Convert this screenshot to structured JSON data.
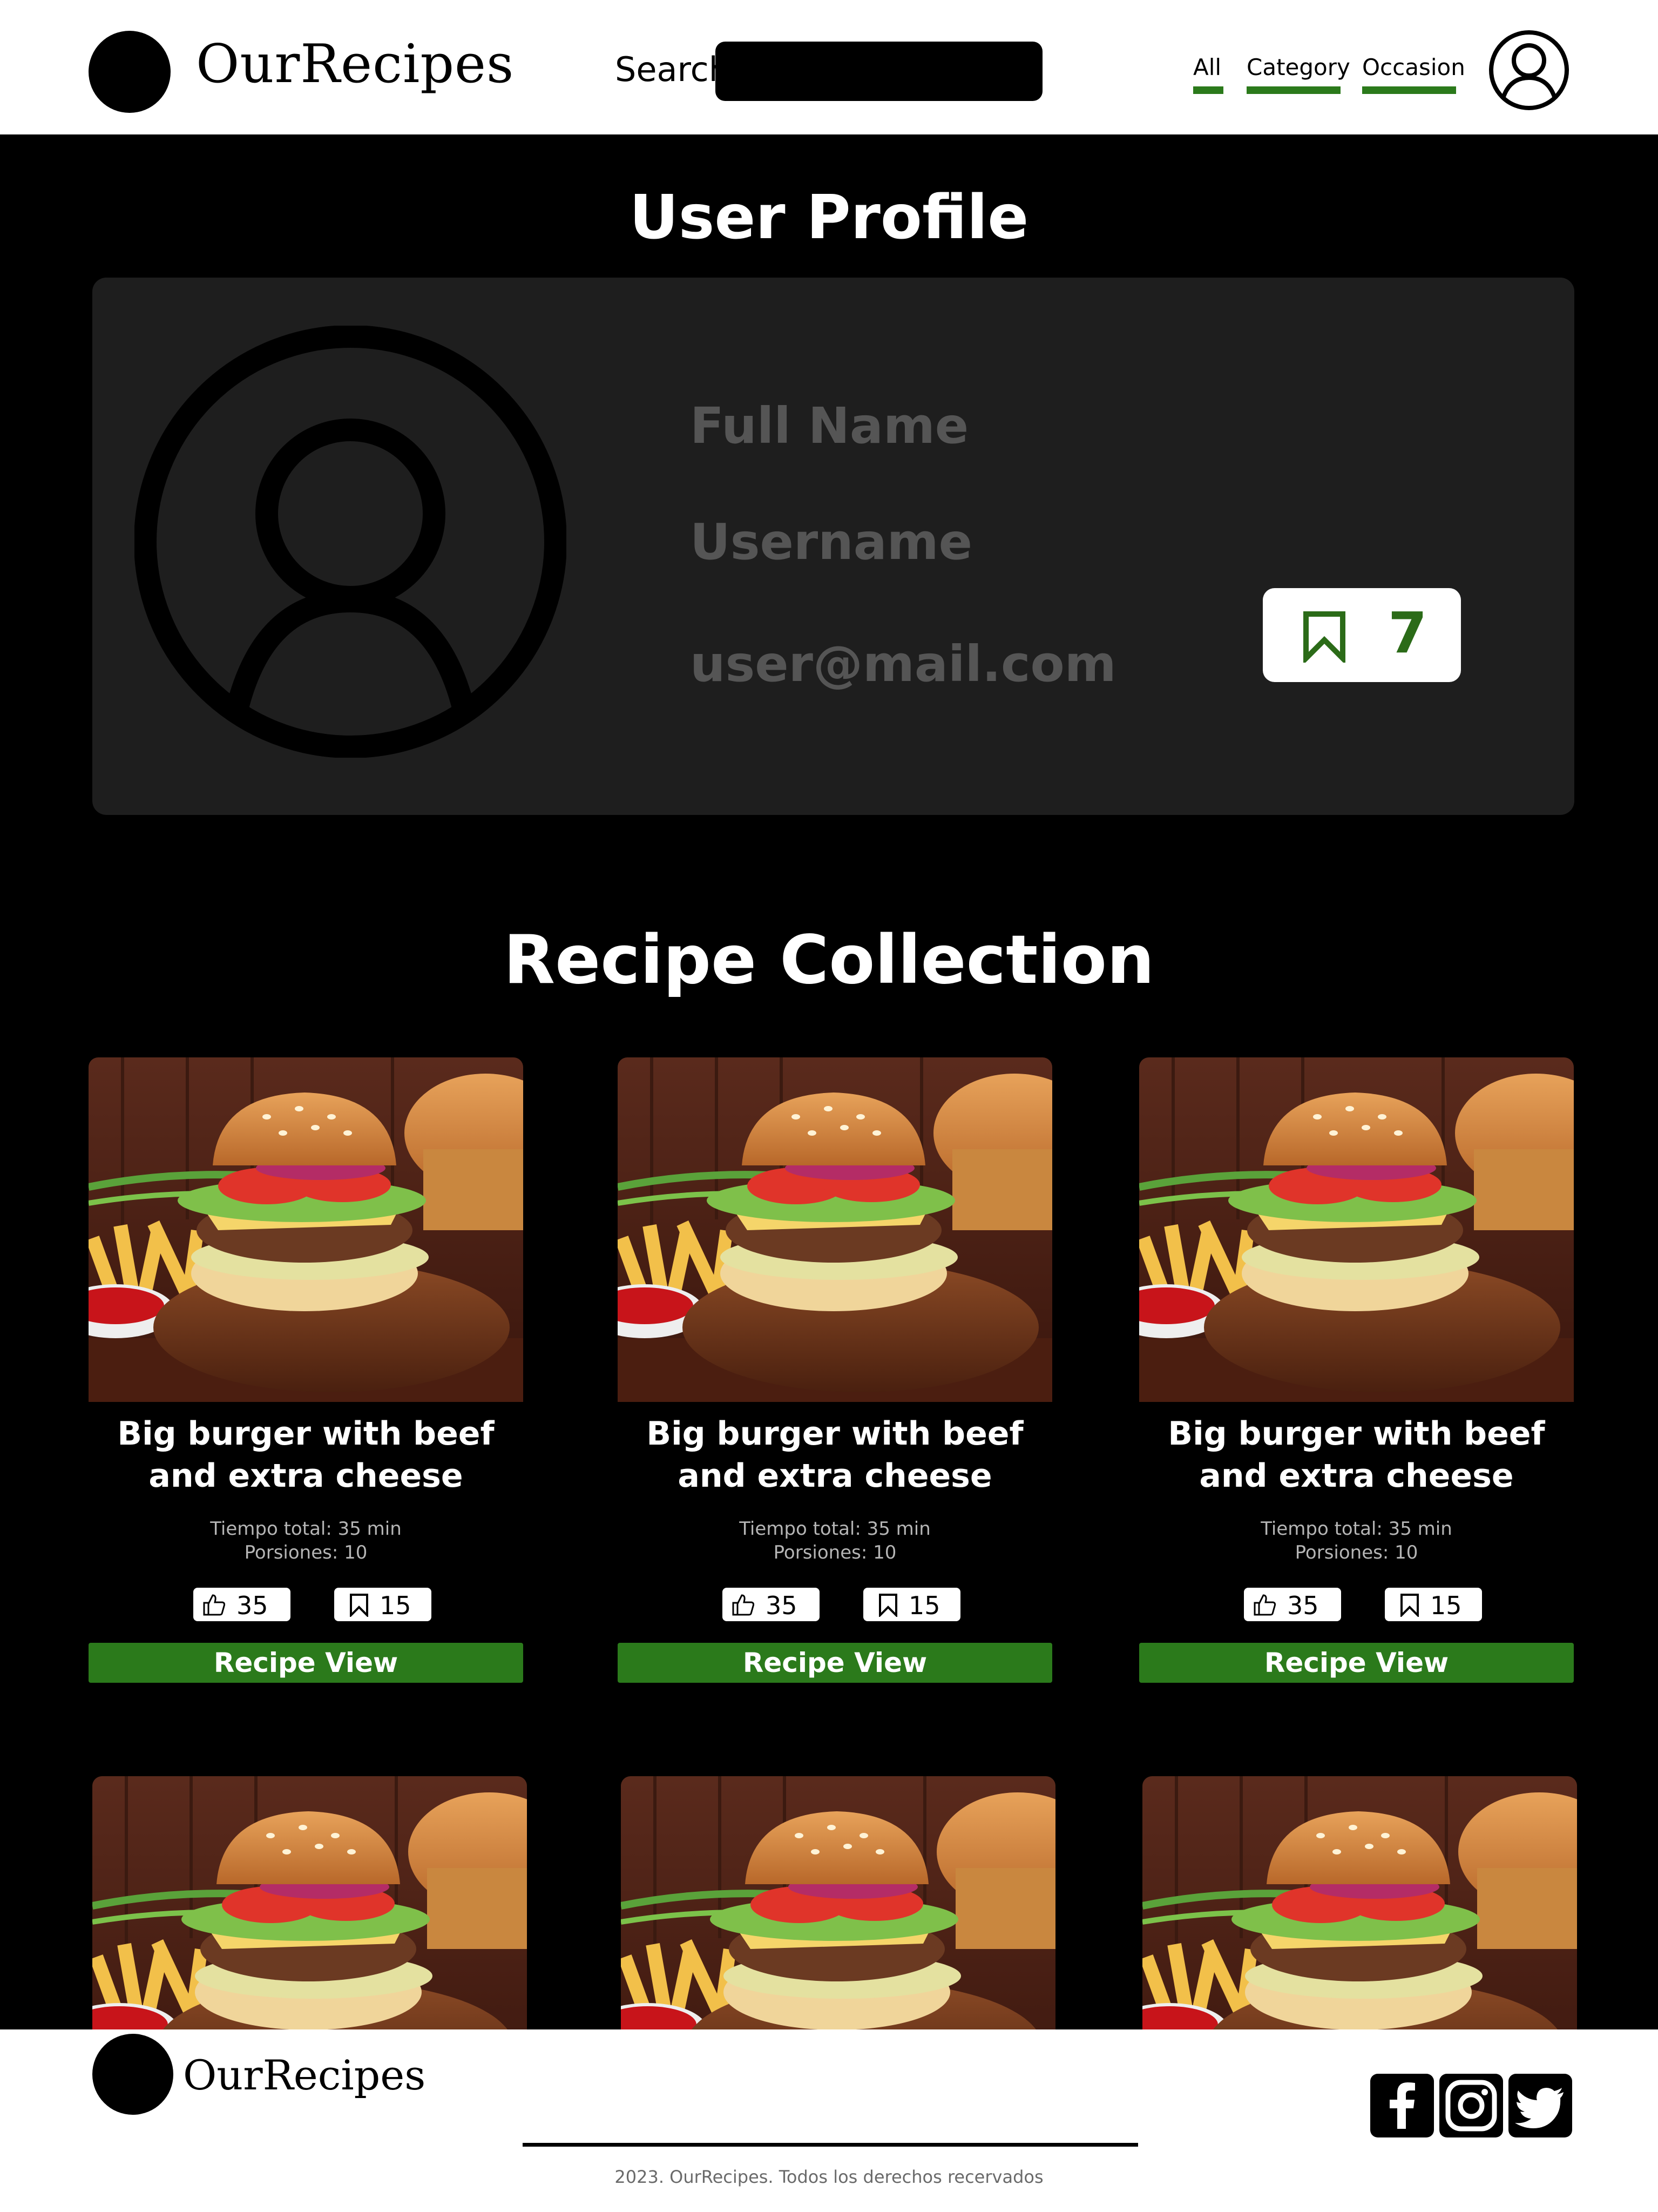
{
  "header": {
    "logo_text": "OurRecipes",
    "search_label": "Search",
    "search_value": "",
    "nav": [
      {
        "label": "All"
      },
      {
        "label": "Category"
      },
      {
        "label": "Occasion"
      }
    ],
    "accent_color": "#2b7a1b"
  },
  "profile": {
    "title": "User Profile",
    "full_name": "Full Name",
    "username": "Username",
    "email": "user@mail.com",
    "saved_count": "7"
  },
  "collection": {
    "title": "Recipe Collection",
    "cards": [
      {
        "title": "Big burger with beef and extra cheese",
        "time": "Tiempo total: 35 min",
        "servings": "Porsiones: 10",
        "likes": "35",
        "saves": "15",
        "button": "Recipe View"
      },
      {
        "title": "Big burger with beef and extra cheese",
        "time": "Tiempo total: 35 min",
        "servings": "Porsiones: 10",
        "likes": "35",
        "saves": "15",
        "button": "Recipe View"
      },
      {
        "title": "Big burger with beef and extra cheese",
        "time": "Tiempo total: 35 min",
        "servings": "Porsiones: 10",
        "likes": "35",
        "saves": "15",
        "button": "Recipe View"
      }
    ]
  },
  "footer": {
    "logo_text": "OurRecipes",
    "copyright": "2023. OurRecipes. Todos los derechos recervados",
    "social": [
      "facebook-icon",
      "instagram-icon",
      "twitter-icon"
    ]
  }
}
